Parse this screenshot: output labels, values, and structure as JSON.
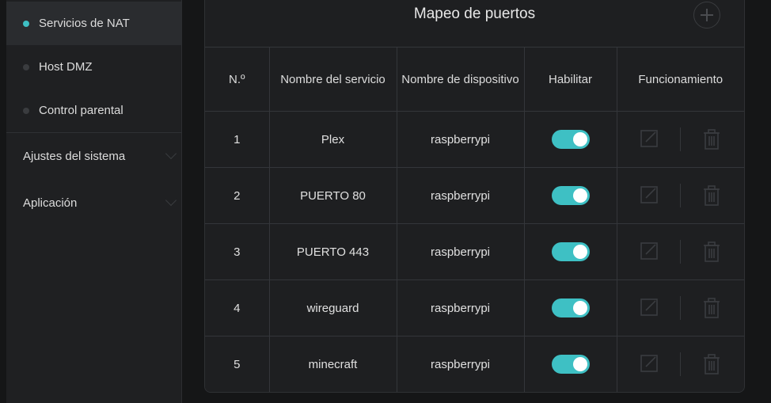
{
  "sidebar": {
    "items": [
      {
        "label": "Servicios de NAT",
        "active": true
      },
      {
        "label": "Host DMZ",
        "active": false
      },
      {
        "label": "Control parental",
        "active": false
      }
    ],
    "groups": [
      {
        "label": "Ajustes del sistema"
      },
      {
        "label": "Aplicación"
      }
    ]
  },
  "panel": {
    "title": "Mapeo de puertos",
    "add_icon": "plus-circle-icon"
  },
  "table": {
    "headers": [
      "N.º",
      "Nombre del servicio",
      "Nombre de dispositivo",
      "Habilitar",
      "Funcionamiento"
    ],
    "rows": [
      {
        "no": "1",
        "service": "Plex",
        "device": "raspberrypi",
        "enabled": true
      },
      {
        "no": "2",
        "service": "PUERTO 80",
        "device": "raspberrypi",
        "enabled": true
      },
      {
        "no": "3",
        "service": "PUERTO 443",
        "device": "raspberrypi",
        "enabled": true
      },
      {
        "no": "4",
        "service": "wireguard",
        "device": "raspberrypi",
        "enabled": true
      },
      {
        "no": "5",
        "service": "minecraft",
        "device": "raspberrypi",
        "enabled": true
      }
    ]
  },
  "colors": {
    "accent": "#3ec0c4",
    "background": "#151617",
    "panel": "#1e1f21",
    "sidebar": "#1f2022"
  },
  "icons": {
    "edit": "edit-icon",
    "delete": "trash-icon"
  }
}
